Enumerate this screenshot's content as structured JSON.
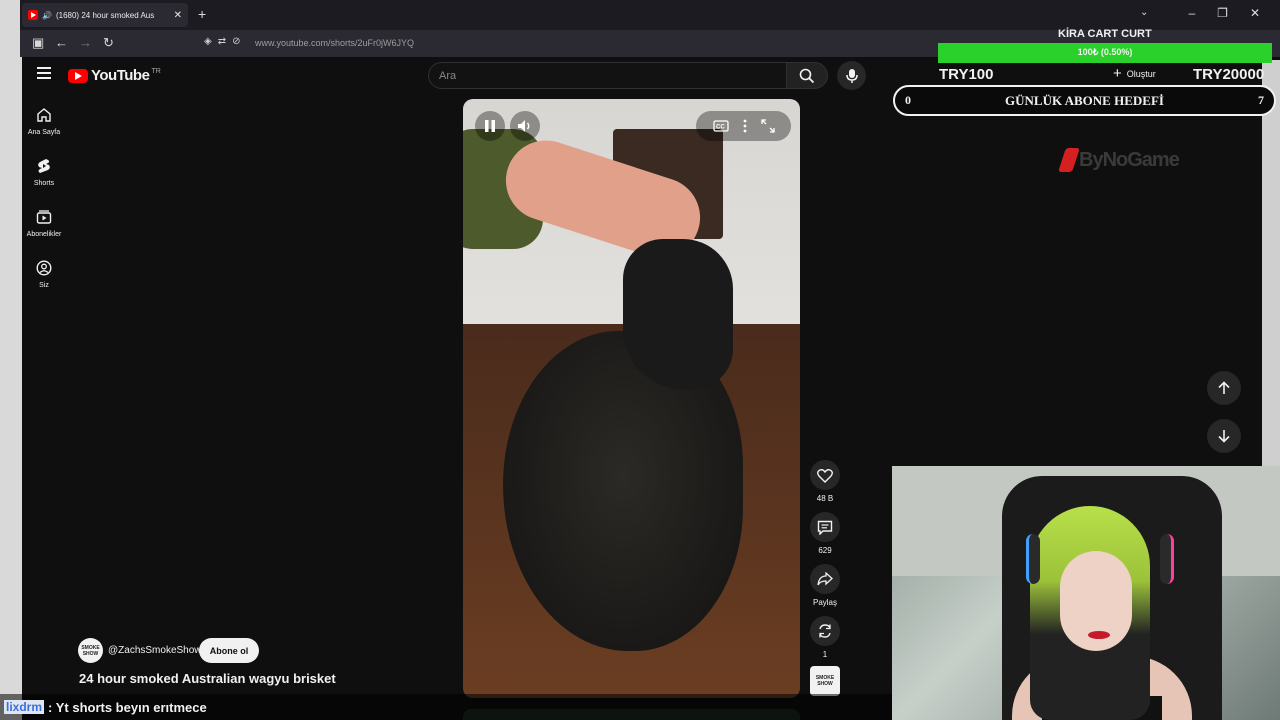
{
  "browser": {
    "tab_title": "(1680) 24 hour smoked Aus",
    "new_tab": "+",
    "url": "www.youtube.com/shorts/2uFr0jW6JYQ"
  },
  "youtube": {
    "logo_text": "YouTube",
    "region": "TR",
    "search_placeholder": "Ara",
    "sidebar": [
      {
        "label": "Ana Sayfa",
        "icon": "home-icon"
      },
      {
        "label": "Shorts",
        "icon": "shorts-icon"
      },
      {
        "label": "Abonelikler",
        "icon": "subscriptions-icon"
      },
      {
        "label": "Siz",
        "icon": "account-icon"
      }
    ],
    "actions": {
      "likes": "48 B",
      "comments": "629",
      "share": "Paylaş",
      "remix": "1"
    },
    "channel": {
      "handle": "@ZachsSmokeShow",
      "avatar_text": "SMOKE SHOW",
      "subscribe_label": "Abone ol"
    },
    "video_title": "24 hour smoked Australian wagyu brisket"
  },
  "stream": {
    "goal_label": "KİRA CART CURT",
    "goal_progress_text": "100₺ (0.50%)",
    "goal_progress_fraction": 0.005,
    "goal_current": "TRY100",
    "goal_target": "TRY20000",
    "create_label": "Oluştur",
    "sub_goal_title": "GÜNLÜK ABONE HEDEFİ",
    "sub_goal_current": "0",
    "sub_goal_target": "7",
    "sponsor": "ByNoGame"
  },
  "chat": {
    "user": "lixdrm",
    "message": ": Yt shorts beyın erıtmece"
  },
  "colors": {
    "youtube_red": "#ff0000",
    "goal_green": "#2bd12b",
    "chat_user": "#3b6fe0"
  }
}
